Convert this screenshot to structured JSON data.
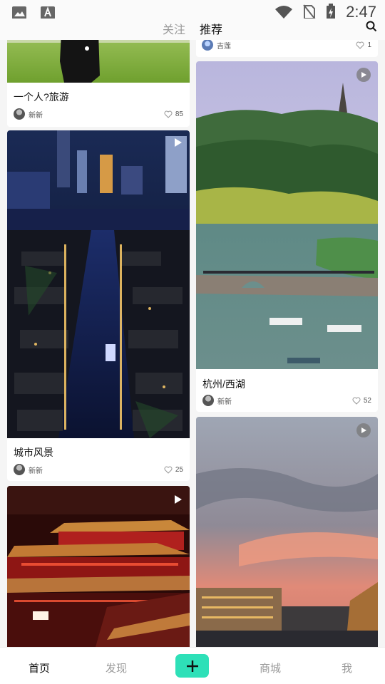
{
  "status_bar": {
    "time": "2:47"
  },
  "top_tabs": {
    "follow": "关注",
    "recommend": "推荐"
  },
  "left_column": [
    {
      "title": "一个人?旅游",
      "user": "新新",
      "likes": "85"
    },
    {
      "title": "城市风景",
      "user": "新新",
      "likes": "25"
    },
    {
      "title": "",
      "user": "",
      "likes": ""
    }
  ],
  "right_column": [
    {
      "title": "",
      "user": "吉莲",
      "likes": "1"
    },
    {
      "title": "杭州/西湖",
      "user": "新新",
      "likes": "52"
    },
    {
      "title": "",
      "user": "",
      "likes": ""
    }
  ],
  "bottom_nav": {
    "home": "首页",
    "discover": "发现",
    "mall": "商城",
    "me": "我"
  },
  "colors": {
    "accent": "#2ee0b8"
  },
  "icons": [
    "gallery-icon",
    "font-icon",
    "wifi-icon",
    "no-sim-icon",
    "battery-charging-icon",
    "search-icon",
    "play-icon",
    "heart-icon",
    "plus-icon"
  ]
}
